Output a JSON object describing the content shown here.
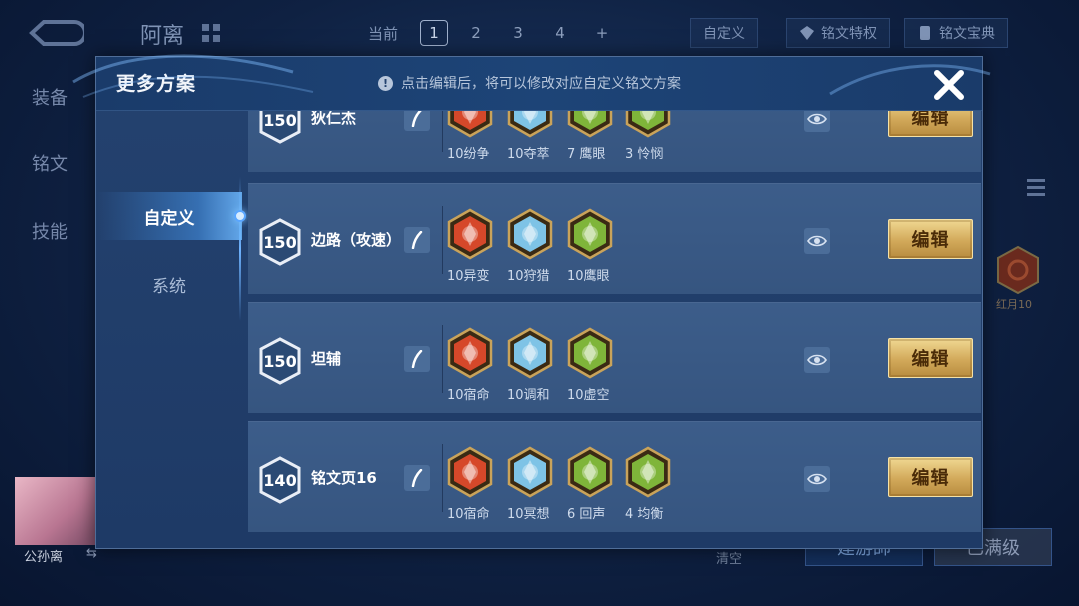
{
  "background": {
    "hero_name": "阿离",
    "side_menu": [
      "装备",
      "铭文",
      "技能"
    ],
    "page_current_label": "当前",
    "pages": [
      "1",
      "2",
      "3",
      "4",
      "+"
    ],
    "custom_label": "自定义",
    "rune_privilege_label": "铭文特权",
    "rune_book_label": "铭文宝典",
    "right_rune_label": "红月10",
    "avatar_name": "公孙离",
    "swap_glyph": "⇆",
    "bottom_small": "清空",
    "bottom_btn_a": "建游師",
    "bottom_btn_b": "已满级"
  },
  "modal": {
    "title": "更多方案",
    "hint": "点击编辑后，将可以修改对应自定义铭文方案",
    "close_glyph": "✕",
    "tabs": [
      {
        "label": "自定义",
        "active": true
      },
      {
        "label": "系统",
        "active": false
      }
    ],
    "edit_label": "编辑",
    "rows": [
      {
        "level": "150",
        "name": "狄仁杰",
        "runes": [
          {
            "label": "10纷争",
            "color": "red"
          },
          {
            "label": "10夺萃",
            "color": "blue"
          },
          {
            "label": "7 鹰眼",
            "color": "green"
          },
          {
            "label": "3 怜悯",
            "color": "green"
          }
        ]
      },
      {
        "level": "150",
        "name": "边路（攻速）",
        "runes": [
          {
            "label": "10异变",
            "color": "red"
          },
          {
            "label": "10狩猎",
            "color": "blue"
          },
          {
            "label": "10鹰眼",
            "color": "green"
          }
        ]
      },
      {
        "level": "150",
        "name": "坦辅",
        "runes": [
          {
            "label": "10宿命",
            "color": "red"
          },
          {
            "label": "10调和",
            "color": "blue"
          },
          {
            "label": "10虚空",
            "color": "green"
          }
        ]
      },
      {
        "level": "140",
        "name": "铭文页16",
        "runes": [
          {
            "label": "10宿命",
            "color": "red"
          },
          {
            "label": "10冥想",
            "color": "blue"
          },
          {
            "label": "6 回声",
            "color": "green"
          },
          {
            "label": "4 均衡",
            "color": "green"
          }
        ]
      }
    ]
  },
  "colors": {
    "red": "#d6482a",
    "blue": "#7ec3e6",
    "green": "#7fb53a",
    "gold": "#d2a95a"
  }
}
